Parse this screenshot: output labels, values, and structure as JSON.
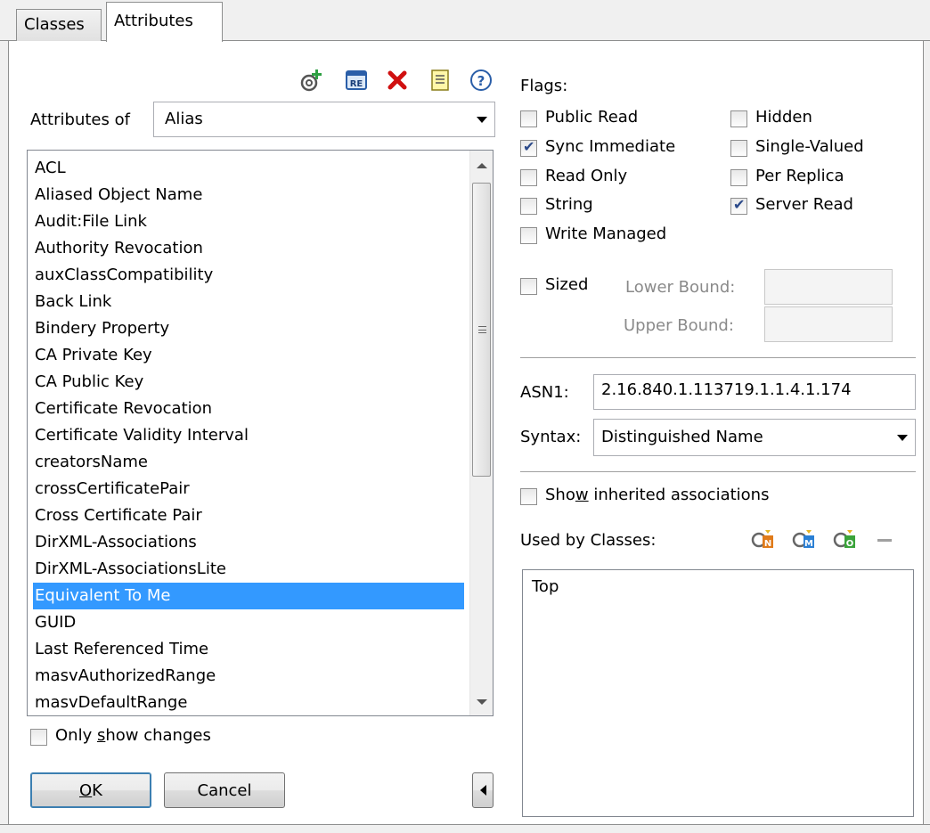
{
  "tabs": [
    {
      "label": "Classes",
      "active": false
    },
    {
      "label": "Attributes",
      "active": true
    }
  ],
  "toolbar": {
    "icons": [
      "add-attribute-icon",
      "rename-attribute-icon",
      "delete-icon",
      "properties-icon",
      "help-icon"
    ],
    "help_glyph": "?",
    "rename_glyph": "RE"
  },
  "attributes_of": {
    "label": "Attributes of",
    "value": "Alias"
  },
  "attribute_list": {
    "items": [
      "ACL",
      "Aliased Object Name",
      "Audit:File Link",
      "Authority Revocation",
      "auxClassCompatibility",
      "Back Link",
      "Bindery Property",
      "CA Private Key",
      "CA Public Key",
      "Certificate Revocation",
      "Certificate Validity Interval",
      "creatorsName",
      "crossCertificatePair",
      "Cross Certificate Pair",
      "DirXML-Associations",
      "DirXML-AssociationsLite",
      "Equivalent To Me",
      "GUID",
      "Last Referenced Time",
      "masvAuthorizedRange",
      "masvDefaultRange"
    ],
    "selected": "Equivalent To Me"
  },
  "only_show_changes": {
    "label_pre": "Only ",
    "label_u": "s",
    "label_post": "how changes",
    "checked": false
  },
  "buttons": {
    "ok_u": "O",
    "ok_rest": "K",
    "cancel": "Cancel"
  },
  "flags": {
    "title": "Flags:",
    "left": [
      {
        "label": "Public Read",
        "checked": false
      },
      {
        "label": "Sync Immediate",
        "checked": true
      },
      {
        "label": "Read Only",
        "checked": false
      },
      {
        "label": "String",
        "checked": false
      },
      {
        "label": "Write Managed",
        "checked": false
      }
    ],
    "right": [
      {
        "label": "Hidden",
        "checked": false
      },
      {
        "label": "Single-Valued",
        "checked": false
      },
      {
        "label": "Per Replica",
        "checked": false
      },
      {
        "label": "Server Read",
        "checked": true
      }
    ]
  },
  "sized": {
    "label": "Sized",
    "checked": false,
    "lower_bound_label": "Lower Bound:",
    "upper_bound_label": "Upper Bound:",
    "lower_bound_value": "",
    "upper_bound_value": ""
  },
  "asn1": {
    "label": "ASN1:",
    "value": "2.16.840.1.113719.1.1.4.1.174"
  },
  "syntax": {
    "label": "Syntax:",
    "value": "Distinguished Name"
  },
  "show_inherited": {
    "label_pre": "Sho",
    "label_u": "w",
    "label_post": " inherited associations",
    "checked": false
  },
  "used_by": {
    "label": "Used by Classes:",
    "icons": [
      "class-n-icon",
      "class-m-icon",
      "class-o-icon",
      "remove-icon"
    ],
    "badge_n": "N",
    "badge_m": "M",
    "badge_o": "O",
    "items": [
      "Top"
    ]
  },
  "colors": {
    "selection": "#3399ff",
    "delete_red": "#d01010",
    "add_green": "#2ea043"
  }
}
